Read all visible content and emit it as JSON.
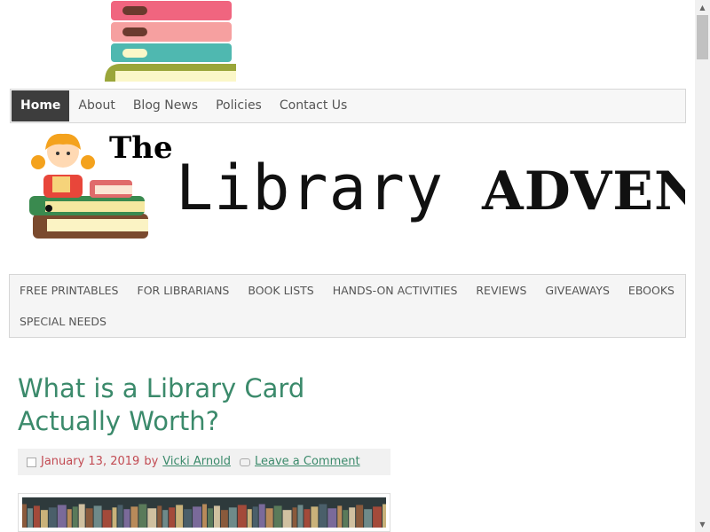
{
  "top_nav": {
    "items": [
      {
        "label": "Home"
      },
      {
        "label": "About"
      },
      {
        "label": "Blog News"
      },
      {
        "label": "Policies"
      },
      {
        "label": "Contact Us"
      }
    ]
  },
  "banner": {
    "the": "The",
    "library": "Library",
    "adventure": "ADVENTU"
  },
  "category_nav": {
    "row1": [
      "FREE PRINTABLES",
      "FOR LIBRARIANS",
      "BOOK LISTS",
      "HANDS-ON ACTIVITIES",
      "REVIEWS",
      "GIVEAWAYS",
      "EBOOKS"
    ],
    "row2": [
      "SPECIAL NEEDS"
    ]
  },
  "post": {
    "title": "What is a Library Card Actually Worth?",
    "date": "January 13, 2019",
    "by": "by",
    "author": "Vicki Arnold",
    "comment_link": "Leave a Comment"
  },
  "colors": {
    "accent_green": "#3b8a6b",
    "date_red": "#c24a52",
    "nav_active": "#3d3d3d"
  }
}
